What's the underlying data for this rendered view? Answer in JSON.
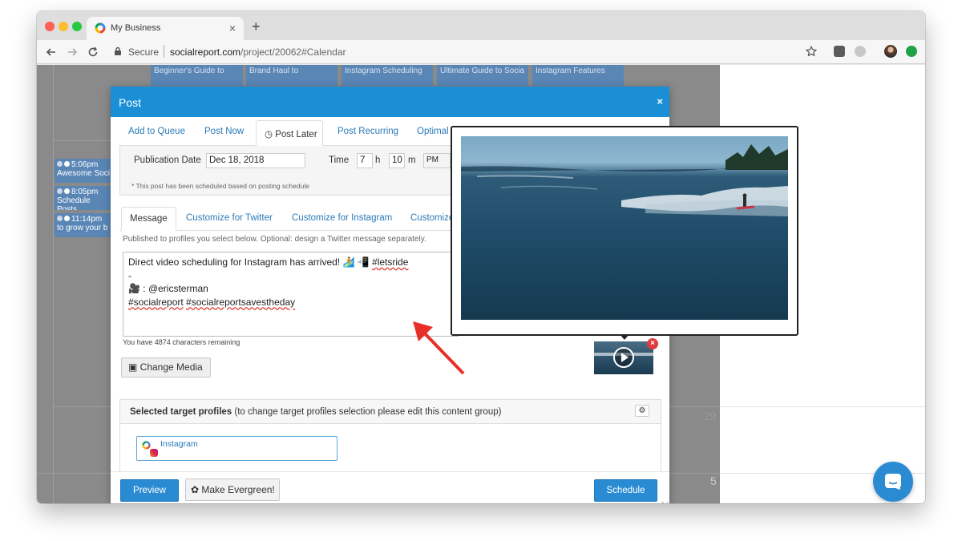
{
  "browser": {
    "tab_title": "My Business",
    "new_tab_symbol": "+",
    "close_symbol": "×",
    "secure_label": "Secure",
    "url_host": "socialreport.com",
    "url_path": "/project/20062#Calendar"
  },
  "calendar": {
    "top_cards": [
      "Beginner's Guide to",
      "Brand Haul to",
      "Instagram Scheduling",
      "Ultimate Guide to Socia",
      "Instagram Features"
    ],
    "events": [
      {
        "time": "5:06pm",
        "text": "Awesome Soci"
      },
      {
        "time": "8:05pm",
        "text": "Schedule Posts"
      },
      {
        "time": "11:14pm",
        "text": "to grow your b"
      }
    ],
    "day_numbers": [
      "29",
      "5"
    ]
  },
  "modal": {
    "title": "Post",
    "close_symbol": "×",
    "tabs": {
      "add_to_queue": "Add to Queue",
      "post_now": "Post Now",
      "post_later": "Post Later",
      "post_recurring": "Post Recurring",
      "optimal": "Optimal"
    },
    "schedule": {
      "publication_date_label": "Publication Date",
      "publication_date_value": "Dec 18, 2018",
      "time_label": "Time",
      "hour_value": "7",
      "hour_unit": "h",
      "minute_value": "10",
      "minute_unit": "m",
      "ampm_value": "PM",
      "note": "* This post has been scheduled based on posting schedule"
    },
    "message_tabs": {
      "message": "Message",
      "customize_twitter": "Customize for Twitter",
      "customize_instagram": "Customize for Instagram",
      "customize_more": "Customize"
    },
    "published_note": "Published to profiles you select below. Optional: design a Twitter message separately.",
    "message": {
      "line1_text": "Direct video scheduling for Instagram has arrived! 🏄 📲 ",
      "line1_hashtag": "#letsride",
      "line2": "-",
      "line3": "🎥 : @ericsterman",
      "line4_hashtag1": "#socialreport",
      "line4_hashtag2": "#socialreportsavestheday"
    },
    "chars_remaining": "You have 4874 characters remaining",
    "change_media_label": "Change Media",
    "remove_media_symbol": "×",
    "profiles": {
      "title_bold": "Selected target profiles",
      "title_rest": " (to change target profiles selection please edit this content group)",
      "items": [
        {
          "name": "Instagram"
        }
      ]
    },
    "footer": {
      "preview_label": "Preview",
      "evergreen_label": "Make Evergreen!",
      "schedule_label": "Schedule"
    }
  },
  "icons": {
    "back": "back-arrow-icon",
    "forward": "forward-arrow-icon",
    "reload": "reload-icon",
    "star": "bookmark-star-icon",
    "chat": "chat-bubble-icon"
  },
  "colors": {
    "accent": "#1a8fd6",
    "button_blue": "#2a8bd3",
    "link_blue": "#2a7ab8",
    "annotation_arrow": "#e8302a",
    "overlay": "#8a8a8a"
  }
}
